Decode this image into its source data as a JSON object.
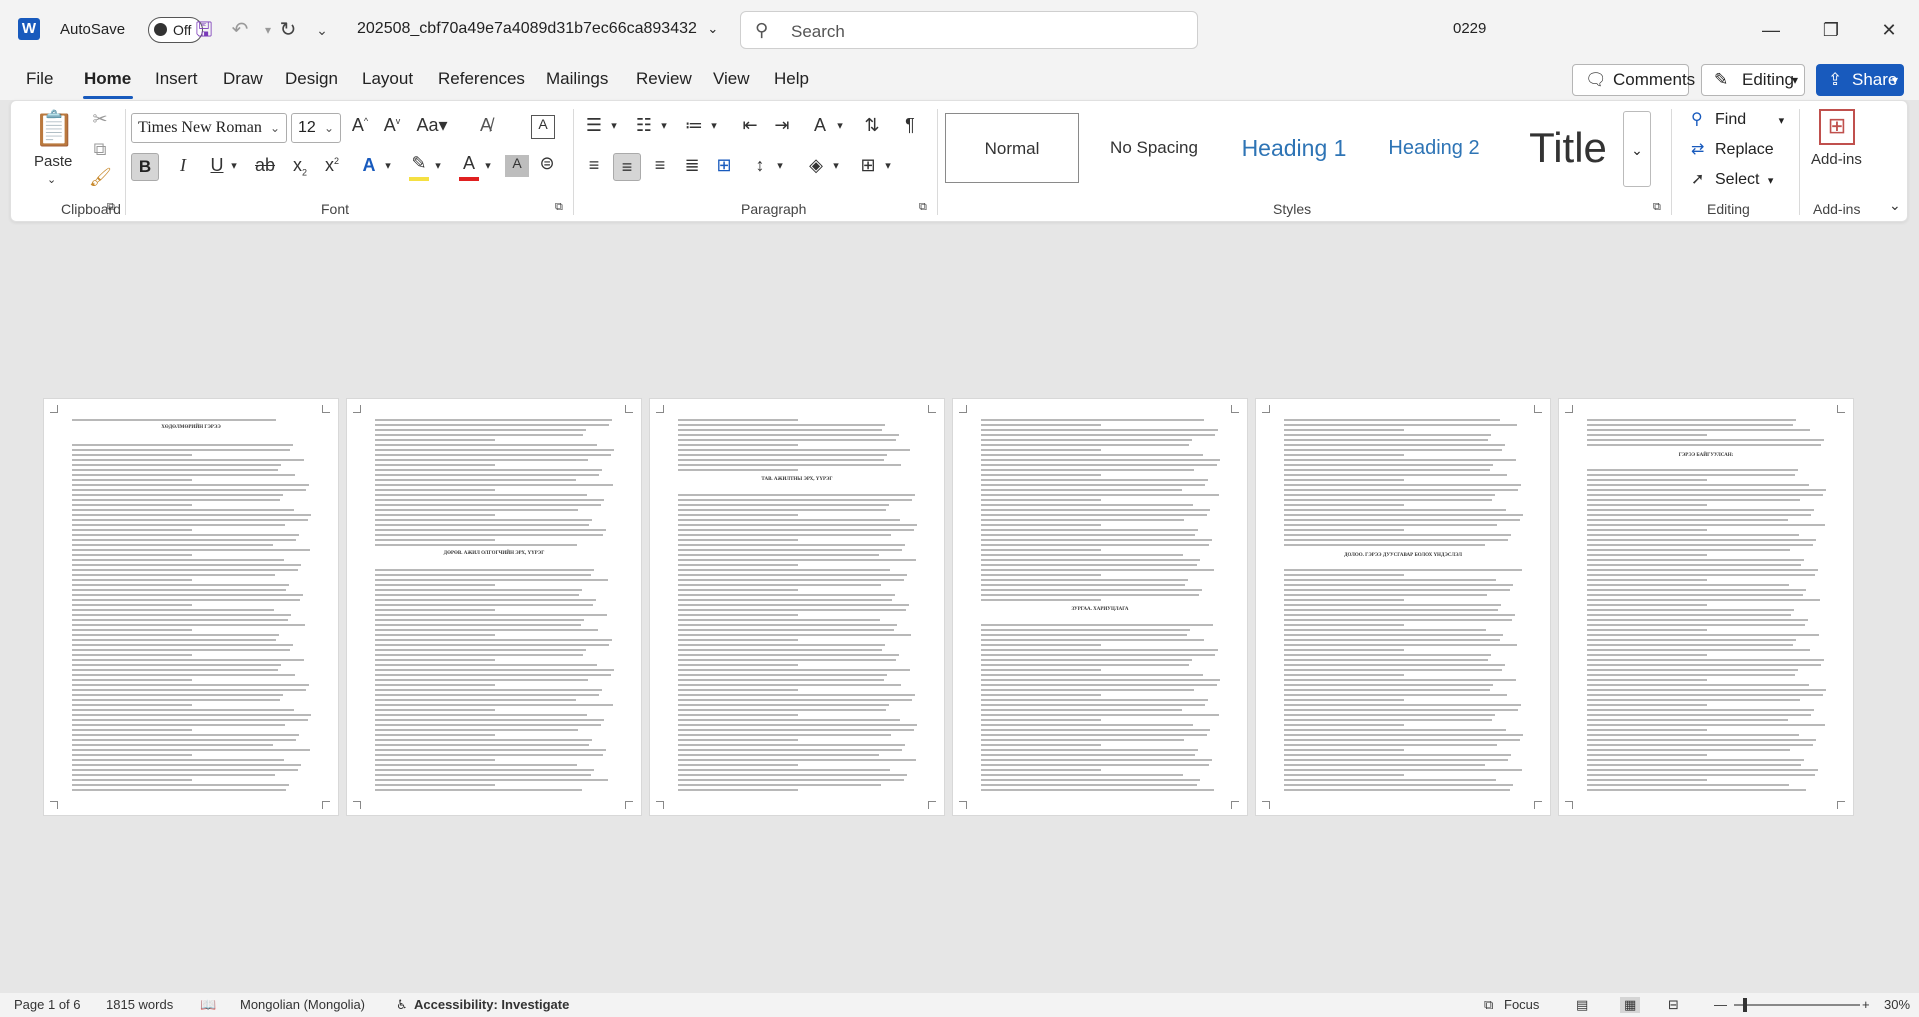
{
  "titlebar": {
    "autosave_label": "AutoSave",
    "autosave_state": "Off",
    "filename": "202508_cbf70a49e7a4089d31b7ec66ca893432",
    "search_placeholder": "Search",
    "user": "0229"
  },
  "menu": {
    "tabs": [
      "File",
      "Home",
      "Insert",
      "Draw",
      "Design",
      "Layout",
      "References",
      "Mailings",
      "Review",
      "View",
      "Help"
    ],
    "active": "Home",
    "comments_label": "Comments",
    "editing_label": "Editing",
    "share_label": "Share"
  },
  "ribbon": {
    "clipboard": {
      "paste_label": "Paste",
      "group_label": "Clipboard"
    },
    "font": {
      "family": "Times New Roman",
      "size": "12",
      "group_label": "Font"
    },
    "paragraph": {
      "group_label": "Paragraph"
    },
    "styles": {
      "group_label": "Styles",
      "items": [
        "Normal",
        "No Spacing",
        "Heading 1",
        "Heading 2",
        "Title"
      ],
      "selected": "Normal"
    },
    "editing": {
      "find_label": "Find",
      "replace_label": "Replace",
      "select_label": "Select",
      "group_label": "Editing"
    },
    "addins": {
      "label": "Add-ins",
      "group_label": "Add-ins"
    },
    "colors": {
      "highlight": "#f5e042",
      "font_color": "#e02020",
      "accent": "#185abd"
    }
  },
  "document": {
    "pages": [
      {
        "heading": "ХӨДӨЛМӨРИЙН ГЭРЭЭ"
      },
      {
        "heading": "ДӨРӨВ. АЖИЛ ОЛГОГЧИЙН ЭРХ, ҮҮРЭГ"
      },
      {
        "heading": "ТАВ. АЖИЛТНЫ ЭРХ, ҮҮРЭГ"
      },
      {
        "heading": "ЗУРГАА. ХАРИУЦЛАГА"
      },
      {
        "heading": "ДОЛОО. ГЭРЭЭ ДУУСГАВАР БОЛОХ ҮНДЭСЛЭЛ"
      },
      {
        "heading": "ГЭРЭЭ БАЙГУУЛСАН:"
      }
    ]
  },
  "statusbar": {
    "page": "Page 1 of 6",
    "words": "1815 words",
    "language": "Mongolian (Mongolia)",
    "accessibility": "Accessibility: Investigate",
    "focus": "Focus",
    "zoom": "30%"
  }
}
